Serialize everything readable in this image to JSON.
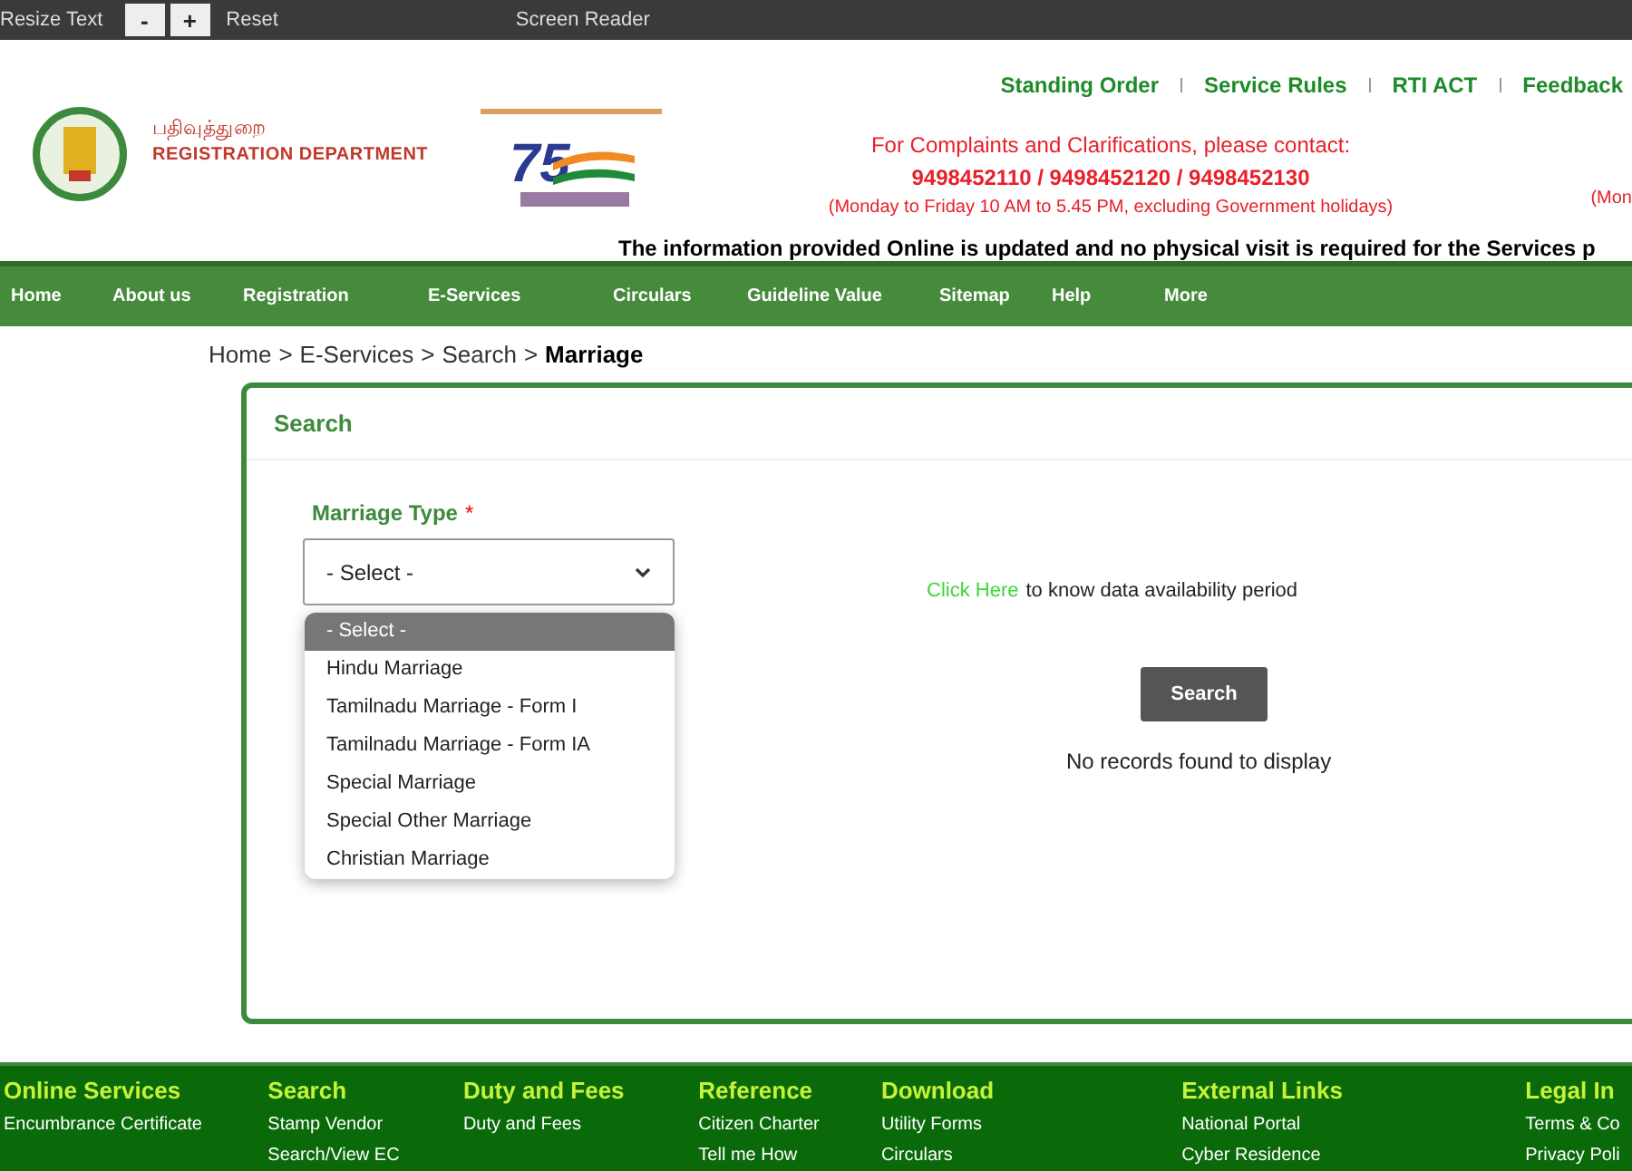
{
  "top_bar": {
    "resize_label": "Resize Text",
    "buttons": [
      "-",
      "+"
    ],
    "reset": "Reset",
    "screen_reader": "Screen Reader"
  },
  "header": {
    "dept_tamil": "பதிவுத்துறை",
    "dept_english": "REGISTRATION DEPARTMENT",
    "links": [
      "Standing Order",
      "Service Rules",
      "RTI ACT",
      "Feedback"
    ],
    "contact": {
      "line": "For Complaints and Clarifications, please contact:",
      "phones": "9498452110 / 9498452120 / 9498452130",
      "hours": "(Monday to Friday 10 AM to 5.45 PM, excluding Government holidays)",
      "hours_2": "(Mon"
    },
    "notice": "The information provided Online is updated and no physical visit is required for the Services p"
  },
  "nav": [
    "Home",
    "About us",
    "Registration",
    "E-Services",
    "Circulars",
    "Guideline Value",
    "Sitemap",
    "Help",
    "More"
  ],
  "logo_text": "75",
  "breadcrumb": {
    "items": [
      "Home",
      "E-Services",
      "Search"
    ],
    "separator": ">",
    "current": "Marriage"
  },
  "search_panel": {
    "title": "Search",
    "field_label": "Marriage Type",
    "required_mark": "*",
    "value": "- Select -",
    "options": [
      {
        "label": "- Select -",
        "selected": true
      },
      {
        "label": "Hindu Marriage",
        "selected": false
      },
      {
        "label": "Tamilnadu Marriage - Form I",
        "selected": false
      },
      {
        "label": "Tamilnadu Marriage - Form IA",
        "selected": false
      },
      {
        "label": "Special Marriage",
        "selected": false
      },
      {
        "label": "Special Other Marriage",
        "selected": false
      },
      {
        "label": "Christian Marriage",
        "selected": false
      }
    ],
    "click_here": "Click Here",
    "click_here_rest": "to know data availability period",
    "search_button": "Search",
    "no_records": "No records found to display"
  },
  "footer": [
    {
      "heading": "Online Services",
      "links": [
        "Encumbrance Certificate"
      ]
    },
    {
      "heading": "Search",
      "links": [
        "Stamp Vendor",
        "Search/View EC"
      ]
    },
    {
      "heading": "Duty and Fees",
      "links": [
        "Duty and Fees"
      ]
    },
    {
      "heading": "Reference",
      "links": [
        "Citizen Charter",
        "Tell me How"
      ]
    },
    {
      "heading": "Download",
      "links": [
        "Utility Forms",
        "Circulars"
      ]
    },
    {
      "heading": "External Links",
      "links": [
        "National Portal",
        "Cyber Residence"
      ]
    },
    {
      "heading": "Legal In",
      "links": [
        "Terms & Co",
        "Privacy Poli"
      ]
    }
  ]
}
